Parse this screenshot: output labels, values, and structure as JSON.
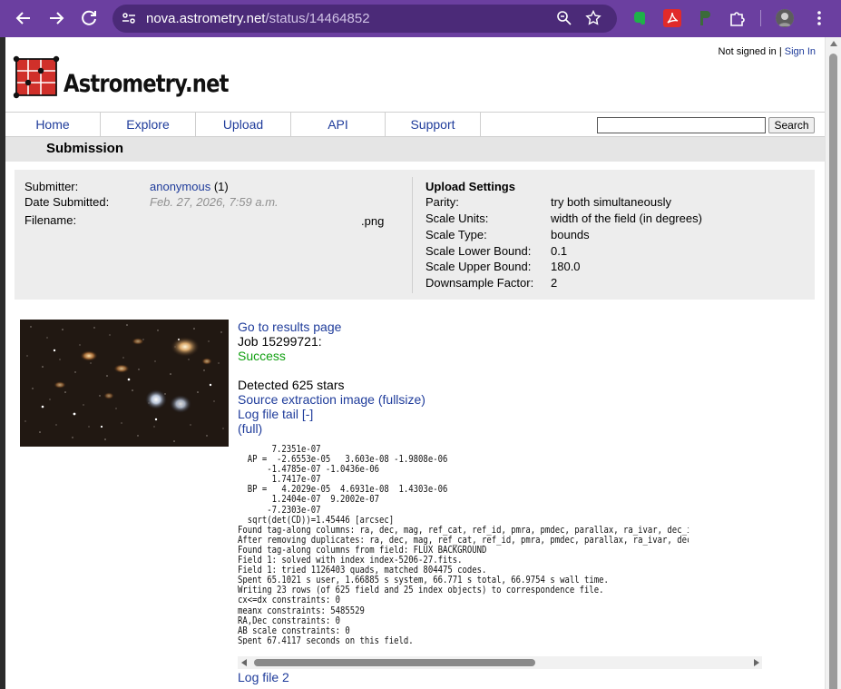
{
  "browser": {
    "url_host": "nova.astrometry.net",
    "url_path": "/status/14464852",
    "icons": [
      "back-arrow-icon",
      "forward-arrow-icon",
      "reload-icon",
      "site-settings-icon",
      "zoom-icon",
      "bookmark-star-icon",
      "evernote-extension-icon",
      "pdf-extension-icon",
      "extension-icon",
      "puzzle-extensions-icon",
      "profile-avatar",
      "menu-kebab-icon"
    ]
  },
  "header": {
    "not_signed_in": "Not signed in",
    "separator": "|",
    "sign_in": "Sign In",
    "logo_text": "Astrometry.net",
    "logo_color": "#d0302a"
  },
  "nav": {
    "items": [
      "Home",
      "Explore",
      "Upload",
      "API",
      "Support"
    ],
    "search_button": "Search",
    "search_value": ""
  },
  "page_title": "Submission",
  "submission": {
    "submitter_label": "Submitter:",
    "submitter_name": "anonymous",
    "submitter_count": "(1)",
    "date_label": "Date Submitted:",
    "date_value": "Feb. 27, 2026, 7:59 a.m.",
    "filename_label": "Filename:",
    "filename_value": ".png"
  },
  "upload_settings": {
    "heading": "Upload Settings",
    "rows": [
      {
        "label": "Parity:",
        "value": "try both simultaneously"
      },
      {
        "label": "Scale Units:",
        "value": "width of the field (in degrees)"
      },
      {
        "label": "Scale Type:",
        "value": "bounds"
      },
      {
        "label": "Scale Lower Bound:",
        "value": "0.1"
      },
      {
        "label": "Scale Upper Bound:",
        "value": "180.0"
      },
      {
        "label": "Downsample Factor:",
        "value": "2"
      }
    ]
  },
  "results": {
    "go_to_results": "Go to results page",
    "job": "Job 15299721:",
    "status": "Success",
    "status_color": "#12a012",
    "detected": "Detected 625 stars",
    "source_extraction": "Source extraction image (fullsize)",
    "log_tail": "Log file tail [-]",
    "full": "(full)",
    "log_lines": [
      "       7.2351e-07",
      "  AP =  -2.6553e-05   3.603e-08 -1.9808e-06",
      "      -1.4785e-07 -1.0436e-06",
      "       1.7417e-07",
      "  BP =   4.2029e-05  4.6931e-08  1.4303e-06",
      "       1.2404e-07  9.2002e-07",
      "      -7.2303e-07",
      "  sqrt(det(CD))=1.45446 [arcsec]",
      "Found tag-along columns: ra, dec, mag, ref_cat, ref_id, pmra, pmdec, parallax, ra_ivar, dec_ivar, p",
      "After removing duplicates: ra, dec, mag, ref_cat, ref_id, pmra, pmdec, parallax, ra_ivar, dec_ivar,",
      "Found tag-along columns from field: FLUX BACKGROUND",
      "Field 1: solved with index index-5206-27.fits.",
      "Field 1: tried 1126403 quads, matched 804475 codes.",
      "Spent 65.1021 s user, 1.66885 s system, 66.771 s total, 66.9754 s wall time.",
      "Writing 23 rows (of 625 field and 25 index objects) to correspondence file.",
      "cx<=dx constraints: 0",
      "meanx constraints: 5485529",
      "RA,Dec constraints: 0",
      "AB scale constraints: 0",
      "Spent 67.4117 seconds on this field."
    ],
    "log_file_2": "Log file 2"
  }
}
